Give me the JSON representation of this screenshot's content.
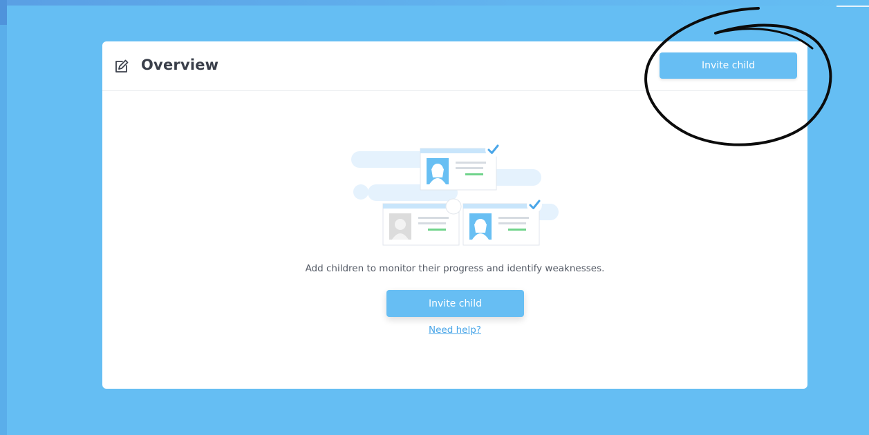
{
  "header": {
    "title": "Overview",
    "icon": "edit-icon",
    "invite_label": "Invite child"
  },
  "empty_state": {
    "message": "Add children to monitor their progress and identify weaknesses.",
    "invite_label": "Invite child",
    "help_label": "Need help?"
  },
  "colors": {
    "background": "#65bef3",
    "card": "#ffffff",
    "accent": "#67bef3",
    "link": "#4aa6e8",
    "title_text": "#3a3f4a",
    "body_text": "#555b66"
  }
}
